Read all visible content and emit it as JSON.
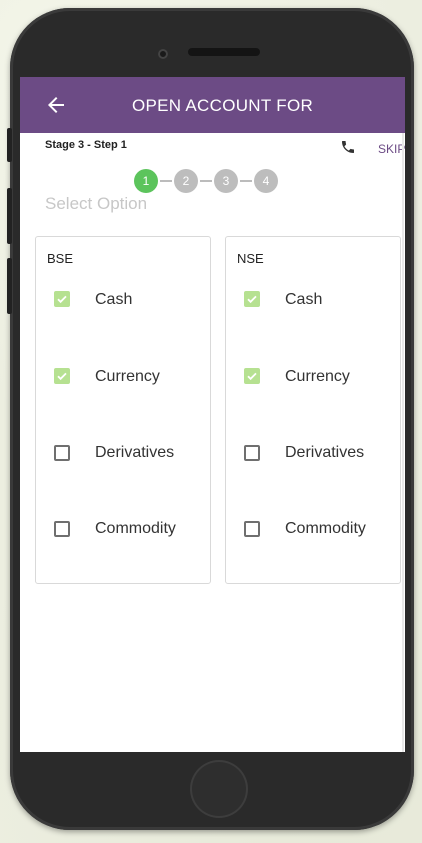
{
  "appbar": {
    "title": "OPEN ACCOUNT FOR",
    "back_icon": "arrow-left-icon"
  },
  "stage": {
    "label": "Stage 3 - Step 1",
    "call_icon": "phone-icon",
    "skip_label": "SKIP"
  },
  "stepper": {
    "steps": [
      "1",
      "2",
      "3",
      "4"
    ],
    "active_index": 0,
    "active_color": "#5cc45c",
    "inactive_color": "#bdbdbd"
  },
  "section": {
    "heading": "Select Option"
  },
  "exchanges": [
    {
      "name": "BSE",
      "options": [
        {
          "label": "Cash",
          "checked": true
        },
        {
          "label": "Currency",
          "checked": true
        },
        {
          "label": "Derivatives",
          "checked": false
        },
        {
          "label": "Commodity",
          "checked": false
        }
      ]
    },
    {
      "name": "NSE",
      "options": [
        {
          "label": "Cash",
          "checked": true
        },
        {
          "label": "Currency",
          "checked": true
        },
        {
          "label": "Derivatives",
          "checked": false
        },
        {
          "label": "Commodity",
          "checked": false
        }
      ]
    }
  ],
  "colors": {
    "appbar": "#6c4b85",
    "checkbox_checked": "#b6e191"
  }
}
